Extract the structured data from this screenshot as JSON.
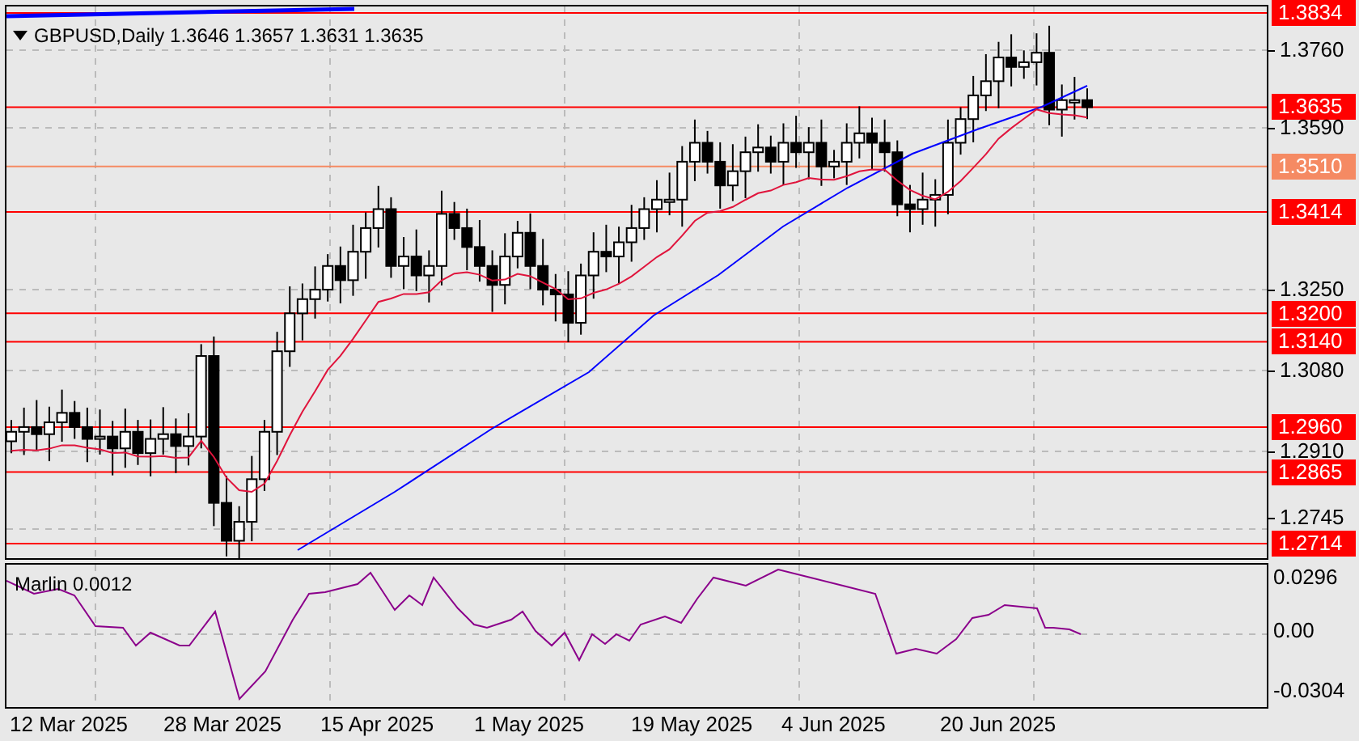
{
  "chart": {
    "title": "GBPUSD,Daily  1.3646 1.3657 1.3631 1.3635",
    "price_axis": [
      {
        "text": "1.3834",
        "kind": "level",
        "color": "#ff0000"
      },
      {
        "text": "1.3760",
        "kind": "tick"
      },
      {
        "text": "1.3635",
        "kind": "level",
        "color": "#ff0000"
      },
      {
        "text": "1.3590",
        "kind": "tick"
      },
      {
        "text": "1.3510",
        "kind": "level",
        "color": "#f58a63"
      },
      {
        "text": "1.3414",
        "kind": "level",
        "color": "#ff0000"
      },
      {
        "text": "1.3250",
        "kind": "tick"
      },
      {
        "text": "1.3200",
        "kind": "level",
        "color": "#ff0000"
      },
      {
        "text": "1.3140",
        "kind": "level",
        "color": "#ff0000"
      },
      {
        "text": "1.3080",
        "kind": "tick"
      },
      {
        "text": "1.2960",
        "kind": "level",
        "color": "#ff0000"
      },
      {
        "text": "1.2910",
        "kind": "tick"
      },
      {
        "text": "1.2865",
        "kind": "level",
        "color": "#ff0000"
      },
      {
        "text": "1.2745",
        "kind": "tick"
      },
      {
        "text": "1.2714",
        "kind": "level",
        "color": "#ff0000"
      }
    ]
  },
  "indicator": {
    "label": "Marlin 0.0012",
    "axis": [
      "0.0296",
      "0.00",
      "-0.0304"
    ]
  },
  "dates": [
    "12 Mar 2025",
    "28 Mar 2025",
    "15 Apr 2025",
    "1 May 2025",
    "19 May 2025",
    "4 Jun 2025",
    "20 Jun 2025"
  ]
}
